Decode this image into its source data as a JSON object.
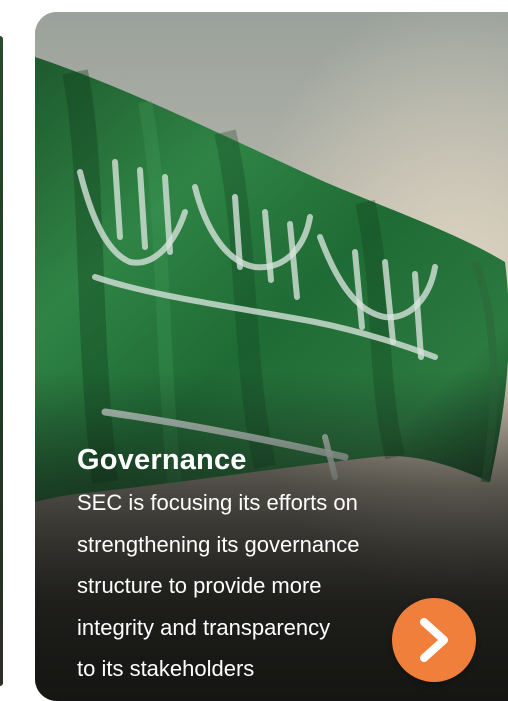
{
  "card": {
    "title": "Governance",
    "description_lines": [
      "SEC is focusing its efforts on",
      "strengthening its governance",
      "structure to provide more",
      "integrity and transparency",
      "to its stakeholders"
    ],
    "image": "saudi-flag-photo",
    "next_icon": "chevron-right-icon"
  },
  "colors": {
    "accent": "#ef7f3a",
    "text": "#ffffff",
    "flag_green": "#1f6b35"
  }
}
